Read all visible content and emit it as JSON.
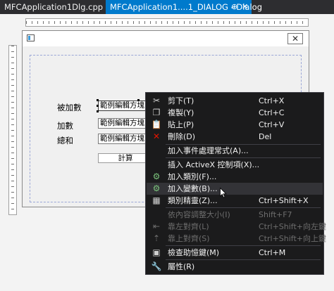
{
  "tabs": {
    "inactive_label": "MFCApplication1Dlg.cpp",
    "active_label": "MFCApplication1....1_DIALOG - Dialog",
    "pin_glyph": "⊕",
    "close_glyph": "✕"
  },
  "dialog": {
    "close_glyph": "✕",
    "labels": {
      "addend": "被加數",
      "augend": "加數",
      "sum": "總和"
    },
    "edits": {
      "addend": "範例編輯方塊",
      "augend": "範例編輯方塊",
      "sum": "範例編輯方塊"
    },
    "button_label": "計算"
  },
  "menu": {
    "items": [
      {
        "icon": "✂",
        "label": "剪下(T)",
        "shortcut": "Ctrl+X"
      },
      {
        "icon": "❐",
        "label": "複製(Y)",
        "shortcut": "Ctrl+C"
      },
      {
        "icon": "📋",
        "label": "貼上(P)",
        "shortcut": "Ctrl+V"
      },
      {
        "icon": "✕",
        "label": "刪除(D)",
        "shortcut": "Del"
      },
      {
        "icon": "",
        "label": "加入事件處理常式(A)...",
        "shortcut": ""
      },
      {
        "icon": "",
        "label": "插入 ActiveX 控制項(X)...",
        "shortcut": ""
      },
      {
        "icon": "⚙",
        "label": "加入類別(F)...",
        "shortcut": ""
      },
      {
        "icon": "⚙",
        "label": "加入變數(B)...",
        "shortcut": ""
      },
      {
        "icon": "▦",
        "label": "類別精靈(Z)...",
        "shortcut": "Ctrl+Shift+X"
      },
      {
        "icon": "",
        "label": "依內容調整大小(I)",
        "shortcut": "Shift+F7"
      },
      {
        "icon": "⇤",
        "label": "靠左對齊(L)",
        "shortcut": "Ctrl+Shift+向左鍵"
      },
      {
        "icon": "⇡",
        "label": "靠上對齊(S)",
        "shortcut": "Ctrl+Shift+向上鍵"
      },
      {
        "icon": "▣",
        "label": "檢查助憶鍵(M)",
        "shortcut": "Ctrl+M"
      },
      {
        "icon": "🔧",
        "label": "屬性(R)",
        "shortcut": ""
      }
    ]
  },
  "colors": {
    "accent": "#007acc",
    "menu_bg": "#1b1b1c",
    "delete_icon": "#e51400"
  }
}
